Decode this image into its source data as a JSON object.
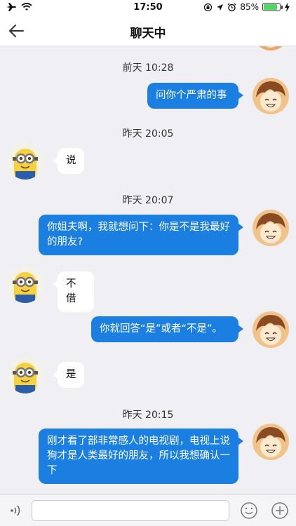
{
  "status": {
    "time": "17:50",
    "battery_percent": "85%",
    "battery_level": 0.85,
    "icons": [
      "airplane-icon",
      "wifi-icon",
      "rotation-lock-icon",
      "location-icon",
      "alarm-icon",
      "bluetooth-icon",
      "battery-icon",
      "charging-icon"
    ]
  },
  "nav": {
    "title": "聊天中",
    "back_icon": "arrow-left-icon"
  },
  "messages": [
    {
      "type": "timestamp",
      "text": "前天 10:28"
    },
    {
      "type": "out",
      "text": "问你个严肃的事"
    },
    {
      "type": "timestamp",
      "text": "昨天 20:05"
    },
    {
      "type": "in",
      "text": "说"
    },
    {
      "type": "timestamp",
      "text": "昨天 20:07"
    },
    {
      "type": "out",
      "text": "你姐夫啊，我就想问下：你是不是我最好的朋友?"
    },
    {
      "type": "in",
      "text": "不借"
    },
    {
      "type": "out",
      "text": "你就回答“是”或者“不是”。"
    },
    {
      "type": "in",
      "text": "是"
    },
    {
      "type": "timestamp",
      "text": "昨天 20:15"
    },
    {
      "type": "out",
      "text": "刚才看了部非常感人的电视剧，电视上说狗才是人类最好的朋友，所以我想确认一下"
    }
  ],
  "input_bar": {
    "voice_icon": "voice-icon",
    "emoji_icon": "emoji-icon",
    "plus_icon": "plus-icon",
    "placeholder": ""
  },
  "colors": {
    "outgoing_bubble": "#1a7fe0",
    "incoming_bubble": "#ffffff",
    "background": "#efeff4"
  }
}
